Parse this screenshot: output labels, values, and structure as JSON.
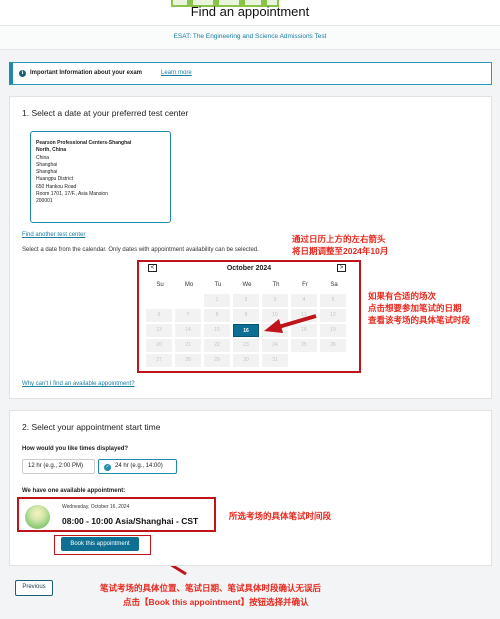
{
  "page": {
    "title": "Find an appointment",
    "exam_name": "ESAT: The Engineering and Science Admissions Test"
  },
  "info_banner": {
    "icon": "info-icon",
    "text": "Important Information about your exam",
    "link": "Learn more"
  },
  "date_section": {
    "title": "1. Select a date at your preferred test center",
    "center_lines": [
      "Pearson Professional Centers-Shanghai",
      "North, China",
      "China",
      "Shanghai",
      "Shanghai",
      "Huangpu District",
      "650 Hankou Road",
      "Room 1701, 17/F., Asia Mansion",
      "200001"
    ],
    "find_another": "Find another test center",
    "instruction": "Select a date from the calendar. Only dates with appointment availability can be selected.",
    "why_link": "Why can't I find an available appointment?"
  },
  "calendar": {
    "month": "October 2024",
    "prev_label": "<",
    "next_label": ">",
    "dow": [
      "Su",
      "Mo",
      "Tu",
      "We",
      "Th",
      "Fr",
      "Sa"
    ],
    "weeks": [
      [
        "",
        "",
        "1",
        "2",
        "3",
        "4",
        "5"
      ],
      [
        "6",
        "7",
        "8",
        "9",
        "10",
        "11",
        "12"
      ],
      [
        "13",
        "14",
        "15",
        "16",
        "17",
        "18",
        "19"
      ],
      [
        "20",
        "21",
        "22",
        "23",
        "24",
        "25",
        "26"
      ],
      [
        "27",
        "28",
        "29",
        "30",
        "31",
        "",
        ""
      ]
    ],
    "selected": "16"
  },
  "time_section": {
    "title": "2. Select your appointment start time",
    "question": "How would you like times displayed?",
    "option_12": "12 hr (e.g., 2:00 PM)",
    "option_24": "24 hr (e.g., 14:00)",
    "available_label": "We have one available appointment:",
    "appointment_date": "Wednesday, October 16, 2024",
    "appointment_time": "08:00 - 10:00 Asia/Shanghai - CST",
    "book_label": "Book this appointment"
  },
  "footer": {
    "previous_label": "Previous"
  },
  "annotations": {
    "calendar_note": [
      "通过日历上方的左右箭头",
      "将日期调整至2024年10月"
    ],
    "date_note": [
      "如果有合适的场次",
      "点击想要参加笔试的日期",
      "查看该考场的具体笔试时段"
    ],
    "time_note": "所选考场的具体笔试时间段",
    "confirm_note": [
      "笔试考场的具体位置、笔试日期、笔试具体时段确认无误后",
      "点击【Book this appointment】按钮选择并确认"
    ]
  },
  "colors": {
    "accent": "#1f8bab",
    "button": "#0e6f93",
    "annotation": "#e8281e",
    "highlight_frame": "#c0141b"
  }
}
